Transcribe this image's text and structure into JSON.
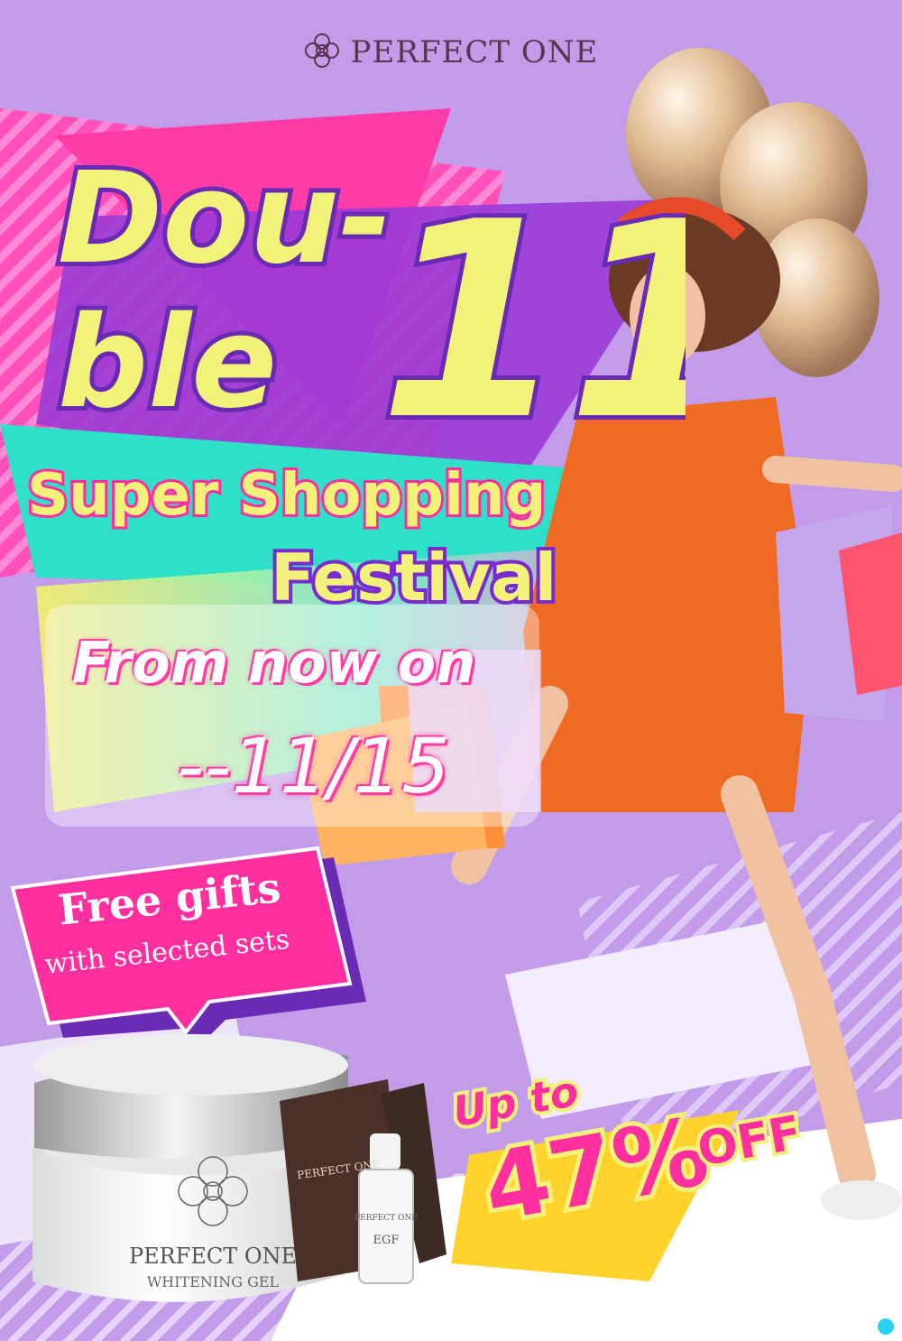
{
  "brand": {
    "name": "PERFECT ONE",
    "logo_icon": "flower-mandala-icon"
  },
  "headline": {
    "word_part1": "Dou-",
    "word_part2": "ble",
    "number": "11"
  },
  "subtitle": {
    "line1": "Super Shopping",
    "line2": "Festival"
  },
  "dates": {
    "line1": "From now on",
    "line2": "--11/15"
  },
  "gift": {
    "line1": "Free gifts",
    "line2": "with selected sets"
  },
  "discount": {
    "prefix": "Up to",
    "value": "47%",
    "suffix": "OFF"
  },
  "products": {
    "jar": {
      "brand": "PERFECT ONE",
      "name": "WHITENING GEL"
    },
    "pouch": {
      "brand": "PERFECT ONE"
    },
    "bottle": {
      "brand": "PERFECT ONE",
      "name": "EGF"
    }
  },
  "colors": {
    "accent": "#ff2fa0",
    "headline_fill": "#f2f27a",
    "headline_stroke": "#6a2bb4",
    "background": "#c29ce9",
    "teal": "#2fe0c8"
  }
}
